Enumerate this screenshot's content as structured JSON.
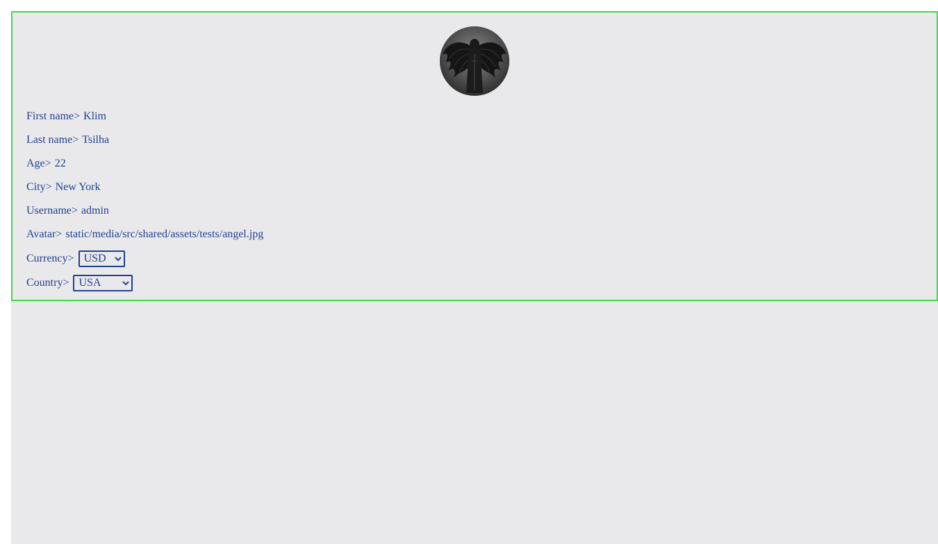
{
  "profile": {
    "avatar_icon": "angel-avatar-image",
    "fields": {
      "first_name": {
        "label": "First name>",
        "value": "Klim"
      },
      "last_name": {
        "label": "Last name>",
        "value": "Tsilha"
      },
      "age": {
        "label": "Age>",
        "value": "22"
      },
      "city": {
        "label": "City>",
        "value": "New York"
      },
      "username": {
        "label": "Username>",
        "value": "admin"
      },
      "avatar": {
        "label": "Avatar>",
        "value": "static/media/src/shared/assets/tests/angel.jpg"
      },
      "currency": {
        "label": "Currency>",
        "selected": "USD"
      },
      "country": {
        "label": "Country>",
        "selected": "USA"
      }
    }
  },
  "colors": {
    "card_border": "#41d94a",
    "text": "#233f8f",
    "background": "#e9e9ec"
  }
}
